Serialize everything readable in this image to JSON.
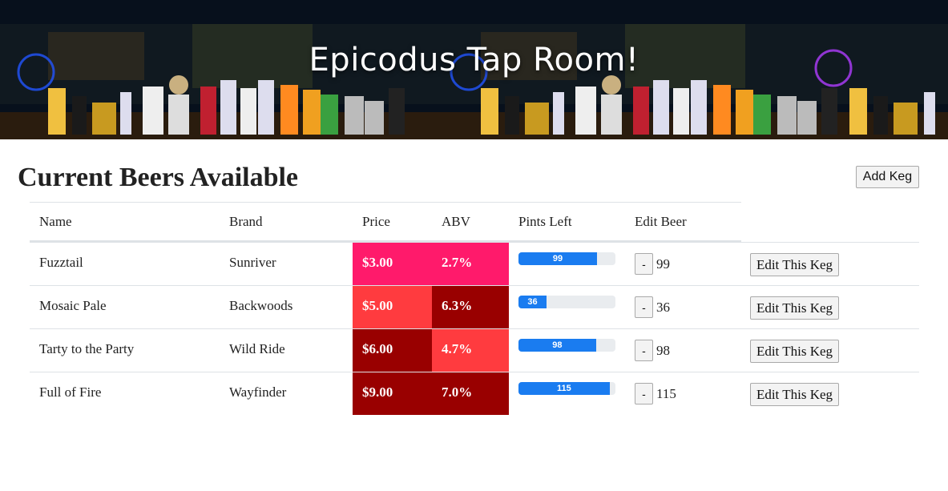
{
  "header": {
    "title": "Epicodus Tap Room!"
  },
  "main": {
    "section_title": "Current Beers Available",
    "add_keg_label": "Add Keg"
  },
  "table": {
    "columns": [
      "Name",
      "Brand",
      "Price",
      "ABV",
      "Pints Left",
      "Edit Beer"
    ],
    "rows": [
      {
        "name": "Fuzztail",
        "brand": "Sunriver",
        "price": "$3.00",
        "abv": "2.7%",
        "pints_left": "99",
        "pints_fraction": 0.81,
        "price_color": "#ff1a6b",
        "abv_color": "#ff1a6b",
        "decrement_label": "-",
        "edit_label": "Edit This Keg"
      },
      {
        "name": "Mosaic Pale",
        "brand": "Backwoods",
        "price": "$5.00",
        "abv": "6.3%",
        "pints_left": "36",
        "pints_fraction": 0.29,
        "price_color": "#ff3b3f",
        "abv_color": "#990000",
        "decrement_label": "-",
        "edit_label": "Edit This Keg"
      },
      {
        "name": "Tarty to the Party",
        "brand": "Wild Ride",
        "price": "$6.00",
        "abv": "4.7%",
        "pints_left": "98",
        "pints_fraction": 0.8,
        "price_color": "#990000",
        "abv_color": "#ff3b3f",
        "decrement_label": "-",
        "edit_label": "Edit This Keg"
      },
      {
        "name": "Full of Fire",
        "brand": "Wayfinder",
        "price": "$9.00",
        "abv": "7.0%",
        "pints_left": "115",
        "pints_fraction": 0.94,
        "price_color": "#990000",
        "abv_color": "#990000",
        "decrement_label": "-",
        "edit_label": "Edit This Keg"
      }
    ]
  },
  "colors": {
    "progress_fill": "#1a7cf0",
    "progress_track": "#e9ecef"
  }
}
